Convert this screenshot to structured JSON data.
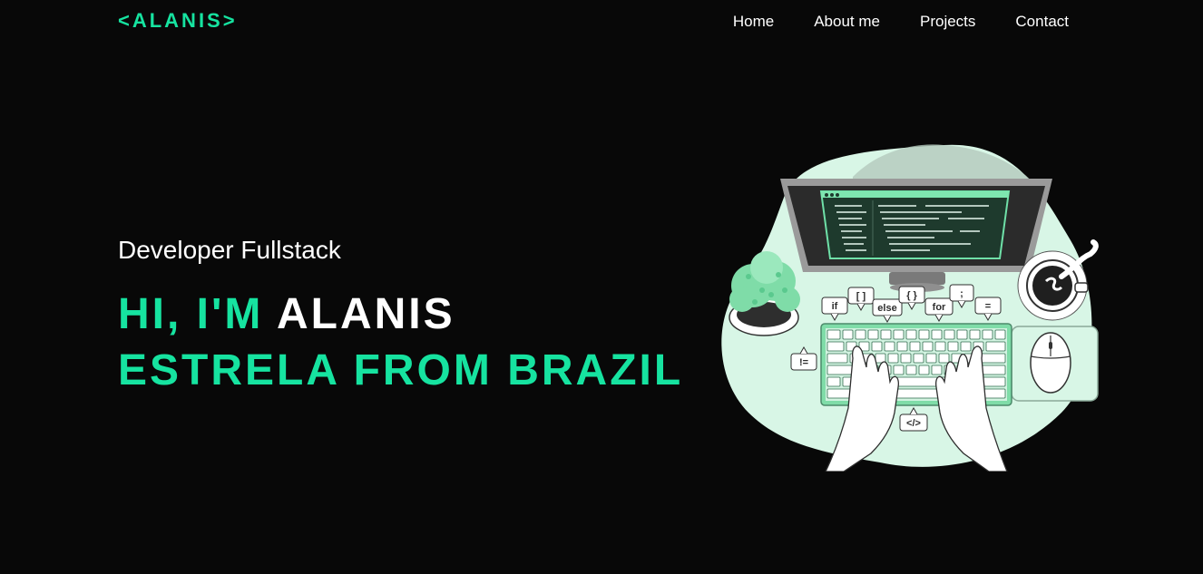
{
  "nav": {
    "logo": "<ALANIS>",
    "links": [
      "Home",
      "About me",
      "Projects",
      "Contact"
    ]
  },
  "hero": {
    "subtitle": "Developer Fullstack",
    "line1_prefix": "HI, I'M ",
    "line1_name": "ALANIS",
    "line2": "ESTRELA FROM BRAZIL"
  },
  "illustration": {
    "icon": "developer-at-desk-illustration",
    "code_bubbles": [
      "if",
      "[ ]",
      "else",
      "{ }",
      "for",
      ";",
      "=",
      "!=",
      "</>"
    ]
  },
  "colors": {
    "background": "#080808",
    "accent": "#16e3a0",
    "text": "#ffffff",
    "blob": "#d8f6e6"
  }
}
